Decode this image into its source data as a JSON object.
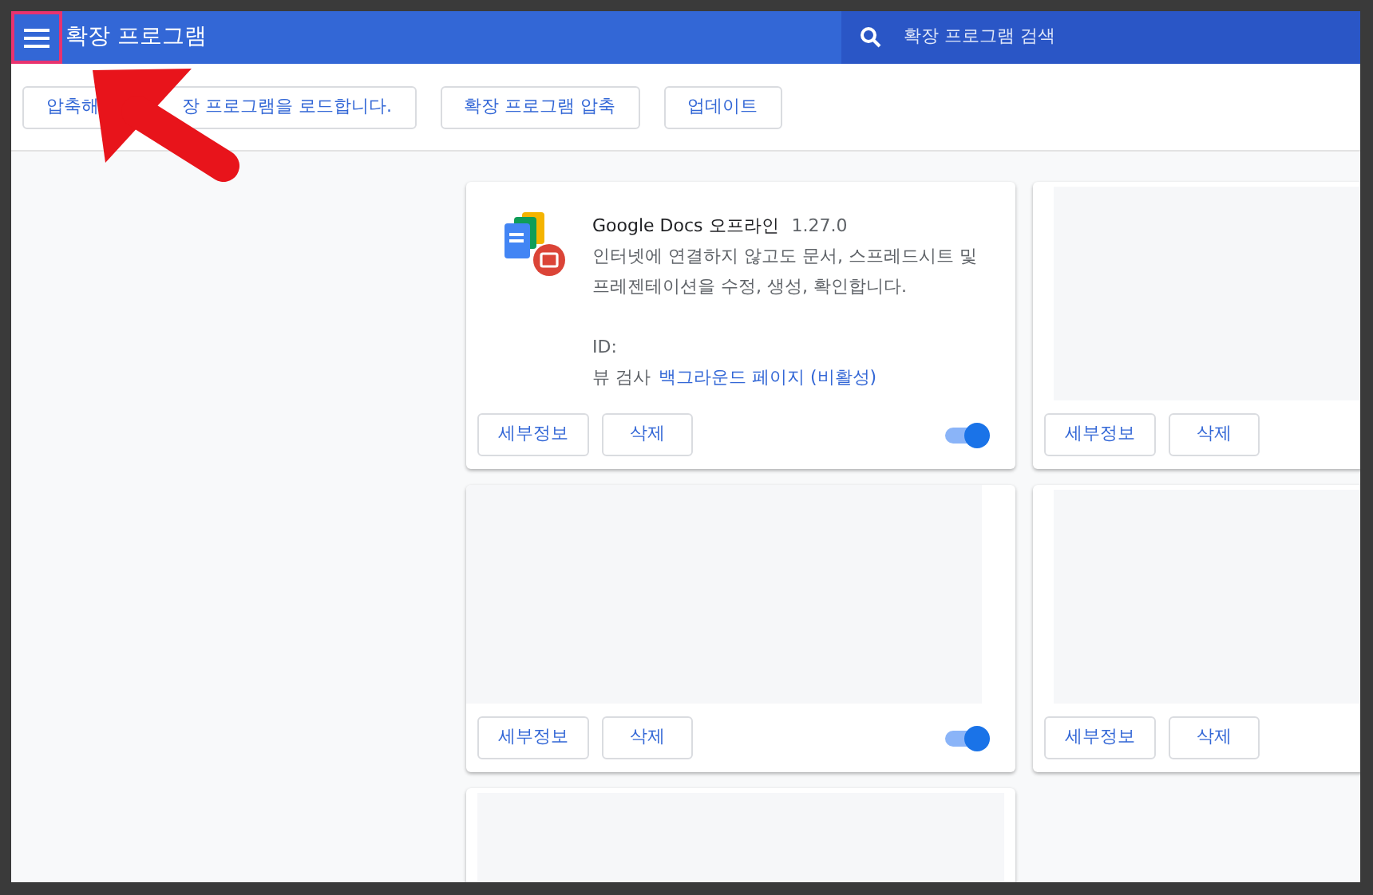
{
  "header": {
    "title": "확장 프로그램",
    "search": {
      "placeholder": "확장 프로그램 검색"
    }
  },
  "toolbar": {
    "buttons": [
      {
        "label_parts": [
          "압축해",
          "장 프로그램을 로드합니다."
        ]
      },
      {
        "label_parts": [
          "확장 프로그램 압축"
        ]
      },
      {
        "label_parts": [
          "업데이트"
        ]
      }
    ]
  },
  "cards": [
    {
      "kind": "full",
      "name": "Google Docs 오프라인",
      "version": "1.27.0",
      "description": "인터넷에 연결하지 않고도 문서, 스프레드시트 및 프레젠테이션을 수정, 생성, 확인합니다.",
      "id_label": "ID:",
      "inspect_label": "뷰 검사",
      "inspect_link": "백그라운드 페이지 (비활성)",
      "buttons": [
        "세부정보",
        "삭제"
      ],
      "on": true
    },
    {
      "kind": "blank",
      "buttons": [
        "세부정보",
        "삭제"
      ]
    },
    {
      "kind": "blank",
      "buttons": [
        "세부정보",
        "삭제"
      ],
      "on": true
    },
    {
      "kind": "blank",
      "buttons": [
        "세부정보",
        "삭제"
      ]
    },
    {
      "kind": "partial"
    }
  ]
}
